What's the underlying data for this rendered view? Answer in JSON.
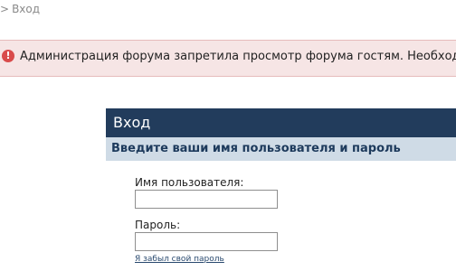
{
  "breadcrumb": {
    "separator": ">",
    "current": "Вход"
  },
  "error": {
    "icon": "exclamation-icon",
    "message": "Администрация форума запретила просмотр форума гостям. Необходимо"
  },
  "login": {
    "title": "Вход",
    "subtitle": "Введите ваши имя пользователя и пароль",
    "username_label": "Имя пользователя:",
    "username_value": "",
    "password_label": "Пароль:",
    "password_value": "",
    "forgot_link": "Я забыл свой пароль"
  },
  "colors": {
    "header_bg": "#223c5c",
    "subheader_bg": "#cfdbe6",
    "error_bg": "#f6e5e5",
    "error_icon": "#d94b4b"
  }
}
